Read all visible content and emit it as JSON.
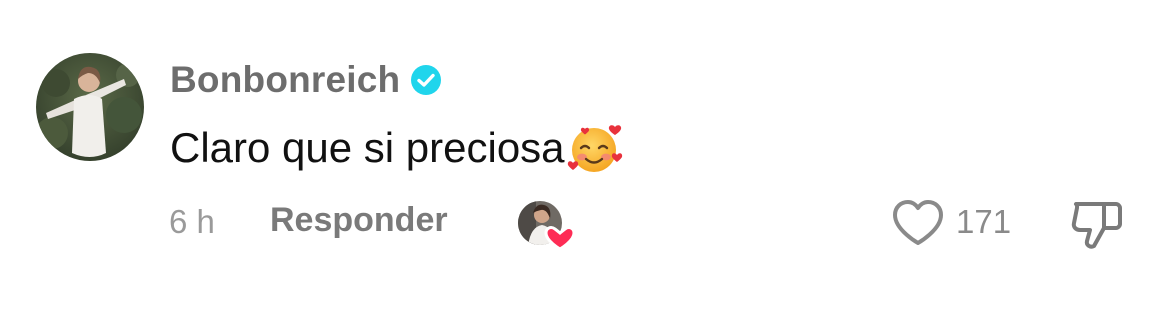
{
  "comment": {
    "username": "Bonbonreich",
    "text": "Claro que si preciosa",
    "emoji": "smiling-face-with-hearts",
    "time": "6 h",
    "reply_label": "Responder",
    "like_count": "171"
  },
  "icons": {
    "verified": "verified-badge-icon",
    "creator_liked": "creator-liked-icon",
    "like": "heart-outline-icon",
    "dislike": "thumbs-down-icon"
  },
  "colors": {
    "verified": "#20d5ec",
    "creator_heart": "#fe2c55",
    "username": "#6d6d6d",
    "text": "#111111",
    "secondary": "#9a9a9a"
  }
}
